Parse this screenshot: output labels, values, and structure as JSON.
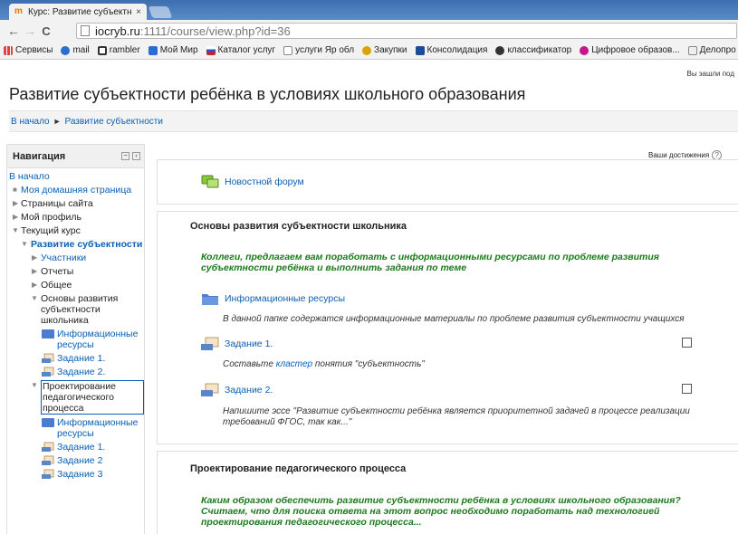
{
  "browser": {
    "tab_title": "Курс: Развитие субъектн",
    "tab_close": "×",
    "address_host": "iocryb.ru",
    "address_path": ":1111/course/view.php?id=36",
    "back": "←",
    "forward": "→",
    "reload": "C"
  },
  "bookmarks": [
    {
      "label": "Сервисы",
      "color": "#d44"
    },
    {
      "label": "mail",
      "color": "#2a6fd0"
    },
    {
      "label": "rambler",
      "color": "#333"
    },
    {
      "label": "Мой Мир",
      "color": "#2a6fd0"
    },
    {
      "label": "Каталог услуг",
      "color": "#c22"
    },
    {
      "label": "услуги Яр обл",
      "color": "#999"
    },
    {
      "label": "Закупки",
      "color": "#d9a400"
    },
    {
      "label": "Консолидация",
      "color": "#1b4c9a"
    },
    {
      "label": "классификатор",
      "color": "#333"
    },
    {
      "label": "Цифровое образов...",
      "color": "#c7168a"
    },
    {
      "label": "Делопро",
      "color": "#999"
    }
  ],
  "page": {
    "logged_in": "Вы зашли под",
    "title": "Развитие субъектности ребёнка в условиях школьного образования",
    "breadcrumb": {
      "home": "В начало",
      "sep": "►",
      "course": "Развитие субъектности"
    },
    "achievements": "Ваши достижения",
    "achievements_help": "?"
  },
  "navigation": {
    "header": "Навигация",
    "items": [
      {
        "label": "В начало"
      },
      {
        "label": "Моя домашняя страница"
      },
      {
        "label": "Страницы сайта"
      },
      {
        "label": "Мой профиль"
      },
      {
        "label": "Текущий курс"
      },
      {
        "label": "Развитие субъектности"
      },
      {
        "label": "Участники"
      },
      {
        "label": "Отчеты"
      },
      {
        "label": "Общее"
      },
      {
        "label": "Основы развития субъектности школьника"
      },
      {
        "label": "Информационные ресурсы"
      },
      {
        "label": "Задание 1."
      },
      {
        "label": "Задание 2."
      },
      {
        "label": "Проектирование педагогического процесса"
      },
      {
        "label": "Информационные ресурсы"
      },
      {
        "label": "Задание 1."
      },
      {
        "label": "Задание 2"
      },
      {
        "label": "Задание 3"
      }
    ]
  },
  "sections": {
    "s0": {
      "forum": "Новостной форум"
    },
    "s1": {
      "title": "Основы развития субъектности школьника",
      "summary": "Коллеги, предлагаем вам поработать с информационными ресурсами по проблеме развития субъектности ребёнка и выполнить задания по теме",
      "resources": "Информационные ресурсы",
      "resources_desc": "В данной папке содержатся информационные материалы по проблеме развития субъектности учащихся",
      "task1": "Задание 1.",
      "task1_desc_a": "Составьте ",
      "task1_desc_link": "кластер",
      "task1_desc_b": " понятия \"субъектность\"",
      "task2": "Задание 2.",
      "task2_desc": "Напишите эссе \"Развитие субъектности ребёнка является приоритетной задачей в процессе реализации требований ФГОС, так как...\""
    },
    "s2": {
      "title": "Проектирование педагогического процесса",
      "summary": "Каким образом обеспечить развитие субъектности ребёнка в условиях школьного образования? Считаем, что для поиска ответа на этот вопрос необходимо поработать над технологией проектирования педагогического процесса..."
    }
  }
}
